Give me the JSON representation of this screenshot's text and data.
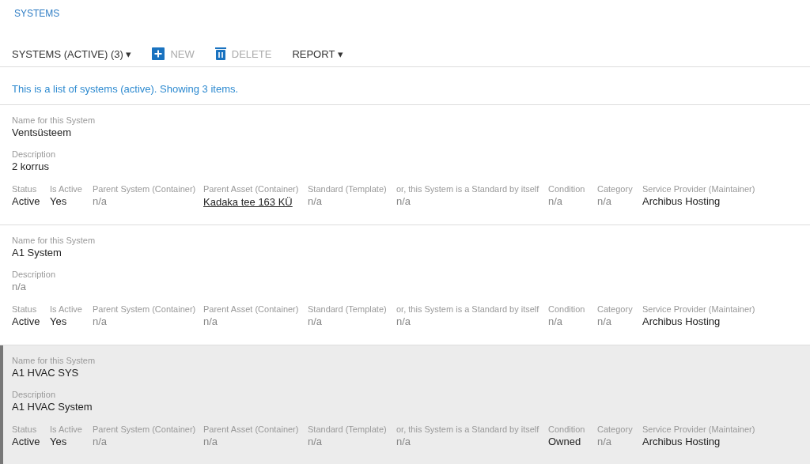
{
  "breadcrumb": "SYSTEMS",
  "toolbar": {
    "view_menu": "SYSTEMS (ACTIVE) (3)",
    "caret": "▾",
    "new_button": {
      "label": "NEW",
      "disabled": true
    },
    "delete_button": {
      "label": "DELETE",
      "disabled": true
    },
    "report_menu": "REPORT"
  },
  "intro": "This is a list of systems (active). Showing 3 items.",
  "items": [
    {
      "selected": false,
      "name_label": "Name for this System",
      "name": "Ventsüsteem",
      "description_label": "Description",
      "description": {
        "text": "2 korrus",
        "kind": "text"
      },
      "fields": [
        {
          "label": "Status",
          "value": "Active",
          "kind": "text"
        },
        {
          "label": "Is Active",
          "value": "Yes",
          "kind": "text"
        },
        {
          "label": "Parent System (Container)",
          "value": "n/a",
          "kind": "muted"
        },
        {
          "label": "Parent Asset (Container)",
          "value": "Kadaka tee 163 KÜ",
          "kind": "link"
        },
        {
          "label": "Standard (Template)",
          "value": "n/a",
          "kind": "muted"
        },
        {
          "label": "or, this System is a Standard by itself",
          "value": "n/a",
          "kind": "muted"
        },
        {
          "label": "Condition",
          "value": "n/a",
          "kind": "muted"
        },
        {
          "label": "Category",
          "value": "n/a",
          "kind": "muted"
        },
        {
          "label": "Service Provider (Maintainer)",
          "value": "Archibus Hosting",
          "kind": "text"
        }
      ]
    },
    {
      "selected": false,
      "name_label": "Name for this System",
      "name": "A1 System",
      "description_label": "Description",
      "description": {
        "text": "n/a",
        "kind": "muted"
      },
      "fields": [
        {
          "label": "Status",
          "value": "Active",
          "kind": "text"
        },
        {
          "label": "Is Active",
          "value": "Yes",
          "kind": "text"
        },
        {
          "label": "Parent System (Container)",
          "value": "n/a",
          "kind": "muted"
        },
        {
          "label": "Parent Asset (Container)",
          "value": "n/a",
          "kind": "muted"
        },
        {
          "label": "Standard (Template)",
          "value": "n/a",
          "kind": "muted"
        },
        {
          "label": "or, this System is a Standard by itself",
          "value": "n/a",
          "kind": "muted"
        },
        {
          "label": "Condition",
          "value": "n/a",
          "kind": "muted"
        },
        {
          "label": "Category",
          "value": "n/a",
          "kind": "muted"
        },
        {
          "label": "Service Provider (Maintainer)",
          "value": "Archibus Hosting",
          "kind": "text"
        }
      ]
    },
    {
      "selected": true,
      "name_label": "Name for this System",
      "name": "A1 HVAC SYS",
      "description_label": "Description",
      "description": {
        "text": "A1 HVAC System",
        "kind": "text"
      },
      "fields": [
        {
          "label": "Status",
          "value": "Active",
          "kind": "text"
        },
        {
          "label": "Is Active",
          "value": "Yes",
          "kind": "text"
        },
        {
          "label": "Parent System (Container)",
          "value": "n/a",
          "kind": "muted"
        },
        {
          "label": "Parent Asset (Container)",
          "value": "n/a",
          "kind": "muted"
        },
        {
          "label": "Standard (Template)",
          "value": "n/a",
          "kind": "muted"
        },
        {
          "label": "or, this System is a Standard by itself",
          "value": "n/a",
          "kind": "muted"
        },
        {
          "label": "Condition",
          "value": "Owned",
          "kind": "text"
        },
        {
          "label": "Category",
          "value": "n/a",
          "kind": "muted"
        },
        {
          "label": "Service Provider (Maintainer)",
          "value": "Archibus Hosting",
          "kind": "text"
        }
      ]
    }
  ]
}
